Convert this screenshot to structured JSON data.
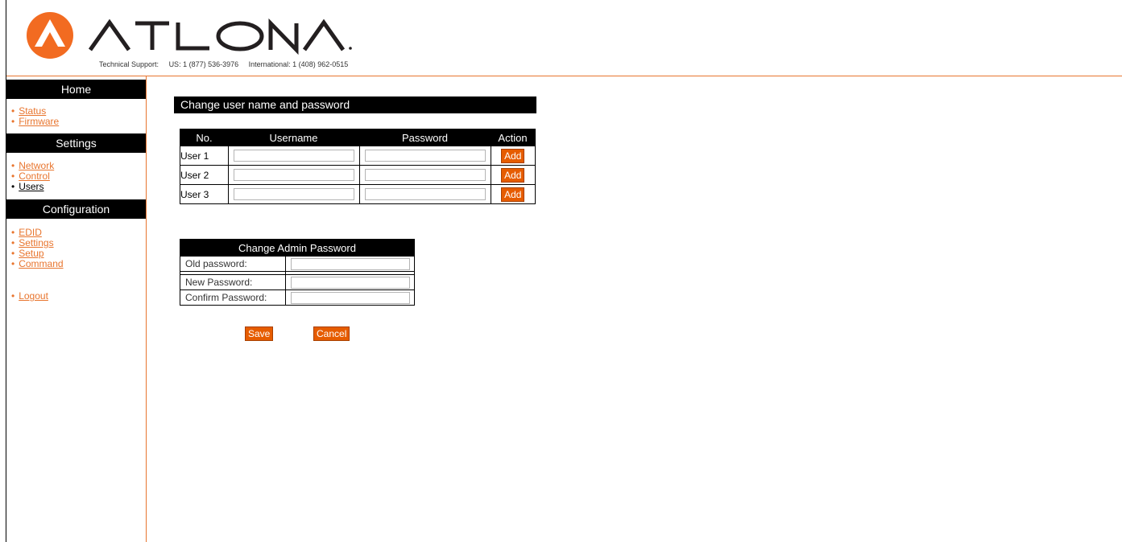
{
  "brand": {
    "logo_text": "ATLONA",
    "support_label": "Technical Support:",
    "support_us": "US: 1 (877) 536-3976",
    "support_intl": "International: 1 (408) 962-0515",
    "accent_color": "#e8752e"
  },
  "sidebar": {
    "home": {
      "heading": "Home",
      "items": [
        {
          "label": "Status",
          "current": false
        },
        {
          "label": "Firmware",
          "current": false
        }
      ]
    },
    "settings": {
      "heading": "Settings",
      "items": [
        {
          "label": "Network",
          "current": false
        },
        {
          "label": "Control",
          "current": false
        },
        {
          "label": "Users",
          "current": true
        }
      ]
    },
    "configuration": {
      "heading": "Configuration",
      "items": [
        {
          "label": "EDID",
          "current": false
        },
        {
          "label": "Settings",
          "current": false
        },
        {
          "label": "Setup",
          "current": false
        },
        {
          "label": "Command",
          "current": false
        }
      ]
    },
    "logout_label": "Logout"
  },
  "users_section": {
    "title": "Change user name and password",
    "headers": {
      "no": "No.",
      "username": "Username",
      "password": "Password",
      "action": "Action"
    },
    "rows": [
      {
        "label": "User 1",
        "username": "",
        "password": "",
        "action": "Add"
      },
      {
        "label": "User 2",
        "username": "",
        "password": "",
        "action": "Add"
      },
      {
        "label": "User 3",
        "username": "",
        "password": "",
        "action": "Add"
      }
    ]
  },
  "admin_section": {
    "title": "Change Admin Password",
    "old_label": "Old password:",
    "new_label": "New Password:",
    "confirm_label": "Confirm Password:",
    "old_value": "",
    "new_value": "",
    "confirm_value": ""
  },
  "buttons": {
    "save": "Save",
    "cancel": "Cancel"
  }
}
